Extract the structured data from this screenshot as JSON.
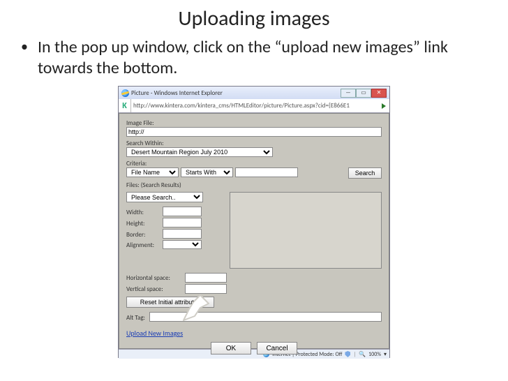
{
  "slide": {
    "title": "Uploading images",
    "bullet": "In the pop up window, click on the “upload new images” link towards the bottom."
  },
  "ie": {
    "title": "Picture - Windows Internet Explorer",
    "url": "http://www.kintera.com/kintera_cms/HTMLEditor/picture/Picture.aspx?cid={E866E1",
    "status": "Internet | Protected Mode: Off",
    "zoom": "100%"
  },
  "dialog": {
    "imageFileLabel": "Image File:",
    "imageFileValue": "http://",
    "searchWithinLabel": "Search Within:",
    "searchWithinValue": "Desert Mountain Region July 2010",
    "criteriaLabel": "Criteria:",
    "criteriaField": "File Name",
    "criteriaOp": "Starts With",
    "searchBtn": "Search",
    "filesLabel": "Files: (Search Results)",
    "filesValue": "Please Search..",
    "widthLabel": "Width:",
    "heightLabel": "Height:",
    "borderLabel": "Border:",
    "alignLabel": "Alignment:",
    "hspaceLabel": "Horizontal space:",
    "vspaceLabel": "Vertical space:",
    "resetBtn": "Reset Initial attributes",
    "altLabel": "Alt Tag:",
    "uploadLink": "Upload New Images",
    "okBtn": "OK",
    "cancelBtn": "Cancel"
  }
}
